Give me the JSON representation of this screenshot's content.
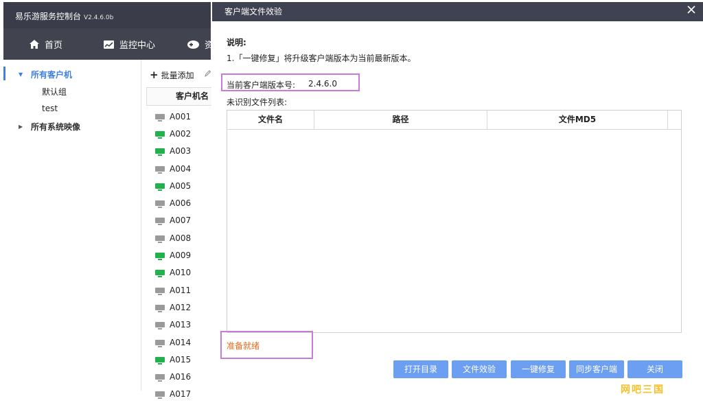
{
  "app": {
    "title": "易乐游服务控制台",
    "version": "V2.4.6.0b"
  },
  "nav": {
    "items": [
      {
        "label": "首页",
        "icon": "home-icon"
      },
      {
        "label": "监控中心",
        "icon": "chart-icon"
      },
      {
        "label": "资",
        "icon": "gamepad-icon"
      }
    ]
  },
  "tree": {
    "all_clients": "所有客户机",
    "default_group": "默认组",
    "test_group": "test",
    "all_images": "所有系统映像"
  },
  "toolbar": {
    "batch_add": "批量添加"
  },
  "client_table": {
    "header": "客户机名",
    "rows": [
      {
        "name": "A001",
        "online": false
      },
      {
        "name": "A002",
        "online": true
      },
      {
        "name": "A003",
        "online": true
      },
      {
        "name": "A004",
        "online": false
      },
      {
        "name": "A005",
        "online": true
      },
      {
        "name": "A006",
        "online": false
      },
      {
        "name": "A007",
        "online": false
      },
      {
        "name": "A008",
        "online": false
      },
      {
        "name": "A009",
        "online": true
      },
      {
        "name": "A010",
        "online": true
      },
      {
        "name": "A011",
        "online": false
      },
      {
        "name": "A012",
        "online": false
      },
      {
        "name": "A013",
        "online": false
      },
      {
        "name": "A014",
        "online": false
      },
      {
        "name": "A015",
        "online": true
      },
      {
        "name": "A016",
        "online": false
      },
      {
        "name": "A017",
        "online": false
      }
    ]
  },
  "dialog": {
    "title": "客户端文件效验",
    "desc_title": "说明:",
    "desc_text": "1.「一键修复」将升级客户端版本为当前最新版本。",
    "version_label": "当前客户端版本号:",
    "version_value": "2.4.6.0",
    "unknown_label": "未识别文件列表:",
    "columns": [
      "文件名",
      "路径",
      "文件MD5"
    ],
    "status": "准备就绪",
    "buttons": {
      "open_dir": "打开目录",
      "verify": "文件效验",
      "repair": "一键修复",
      "sync": "同步客户端",
      "close": "关闭"
    }
  },
  "watermark": "网吧三国",
  "colors": {
    "accent": "#3f7fe0",
    "button": "#6c9ef1",
    "status": "#ea6a1f",
    "highlight_box": "#c77bd8",
    "online": "#23b14d",
    "offline": "#9a9a9a"
  }
}
